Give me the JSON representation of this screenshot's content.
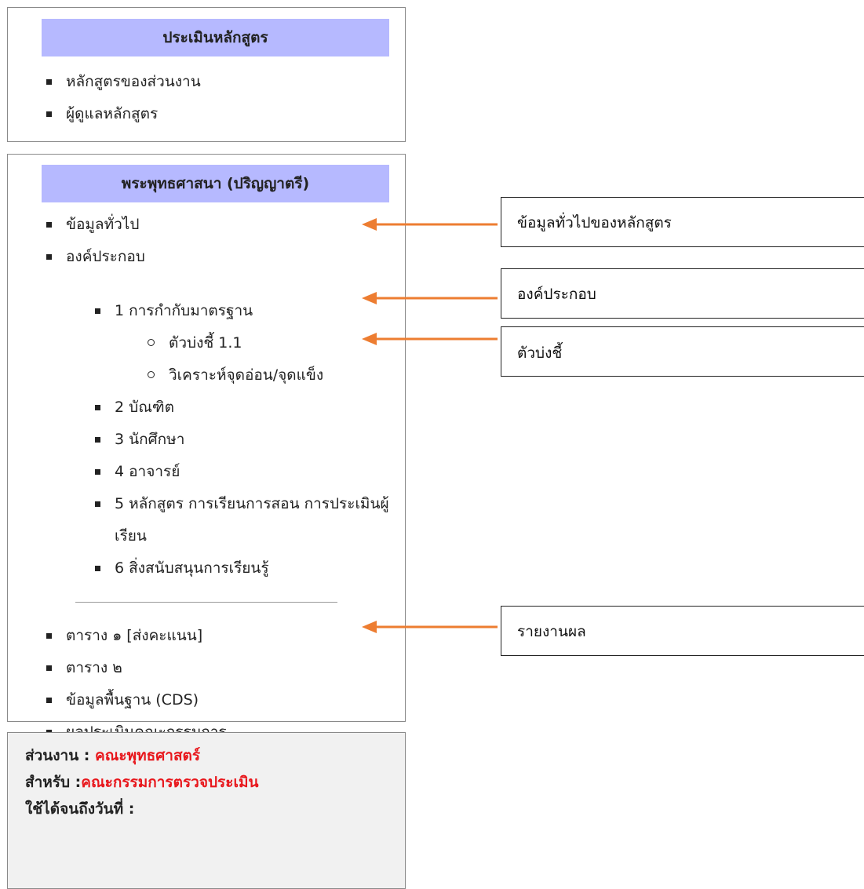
{
  "box1": {
    "title": "ประเมินหลักสูตร",
    "items": [
      "หลักสูตรของส่วนงาน",
      "ผู้ดูแลหลักสูตร"
    ]
  },
  "box2": {
    "title": "พระพุทธศาสนา (ปริญญาตรี)",
    "top_items": [
      "ข้อมูลทั่วไป",
      "องค์ประกอบ"
    ],
    "components": [
      "1 การกำกับมาตรฐาน",
      "2 บัณฑิต",
      "3 นักศึกษา",
      "4 อาจารย์",
      "5 หลักสูตร การเรียนการสอน การประเมินผู้เรียน",
      "6 สิ่งสนับสนุนการเรียนรู้"
    ],
    "sub_items": [
      "ตัวบ่งชี้ 1.1",
      "วิเคราะห์จุดอ่อน/จุดแข็ง"
    ],
    "report_items": [
      "ตาราง ๑ [ส่งคะแนน]",
      "ตาราง ๒",
      "ข้อมูลพื้นฐาน (CDS)",
      "ผลประเมินคณะกรรมการ"
    ]
  },
  "info": {
    "unit_label": "ส่วนงาน : ",
    "unit_value": "คณะพุทธศาสตร์",
    "for_label": "สำหรับ :",
    "for_value": "คณะกรรมการตรวจประเมิน",
    "valid_label": "ใช้ได้จนถึงวันที่ :"
  },
  "callouts": [
    "ข้อมูลทั่วไปของหลักสูตร",
    "องค์ประกอบ",
    "ตัวบ่งชี้",
    "รายงานผล"
  ],
  "colors": {
    "header_bg": "#b6b9ff",
    "arrow": "#ed7d31",
    "info_value": "#e8171c"
  }
}
